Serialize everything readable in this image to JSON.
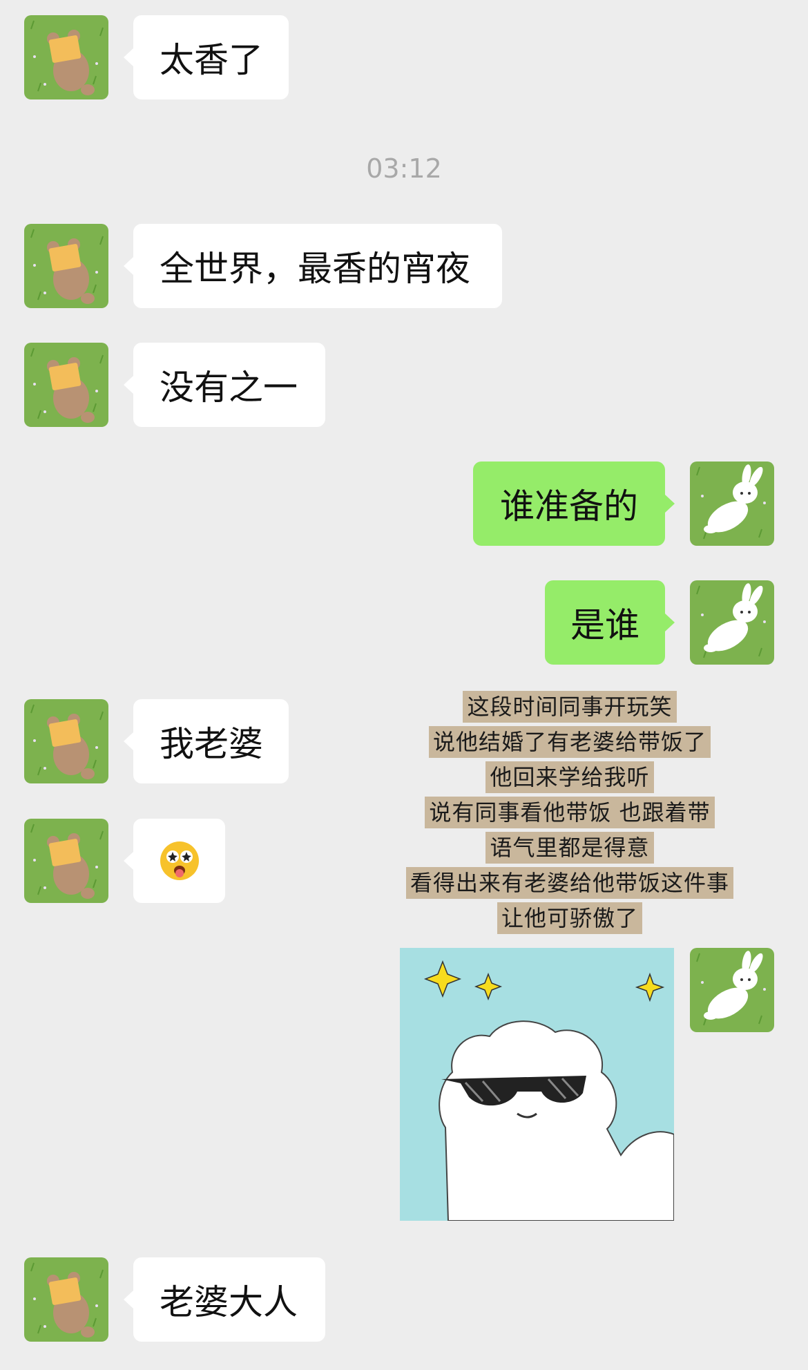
{
  "timestamp": "03:12",
  "messages": [
    {
      "side": "in",
      "text": "太香了"
    },
    {
      "side": "in",
      "text": "全世界，最香的宵夜"
    },
    {
      "side": "in",
      "text": "没有之一"
    },
    {
      "side": "out",
      "text": "谁准备的"
    },
    {
      "side": "out",
      "text": "是谁"
    },
    {
      "side": "in",
      "text": "我老婆"
    },
    {
      "side": "in",
      "emoji": "starstruck-tongue-emoji"
    },
    {
      "side": "in",
      "text": "老婆大人"
    }
  ],
  "overlay_caption": [
    "这段时间同事开玩笑",
    "说他结婚了有老婆给带饭了",
    "他回来学给我听",
    "说有同事看他带饭 也跟着带",
    "语气里都是得意",
    "看得出来有老婆给他带饭这件事",
    "让他可骄傲了"
  ],
  "sticker": {
    "icon": "sunglasses-bear-sticker",
    "background": "#a7dfe2"
  },
  "colors": {
    "incoming_bubble": "#ffffff",
    "outgoing_bubble": "#95ec69",
    "background": "#ededed",
    "timestamp": "#a8a8a8"
  },
  "avatars": {
    "incoming": "bear-on-grass-avatar",
    "outgoing": "rabbit-on-grass-avatar"
  }
}
